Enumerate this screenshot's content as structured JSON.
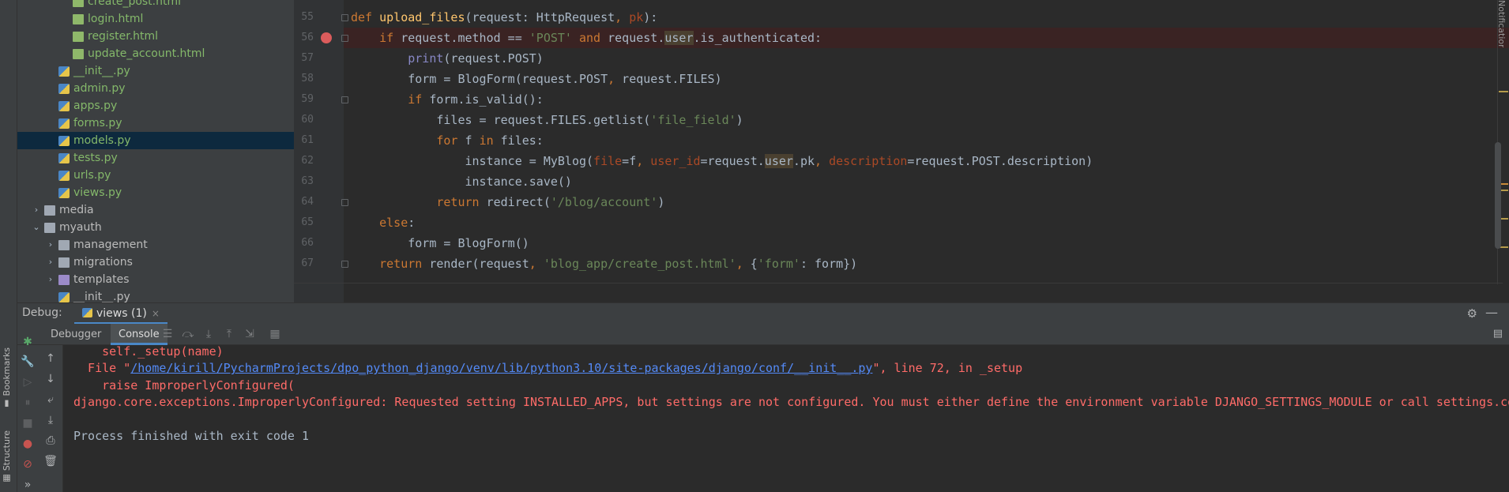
{
  "left_strip": {
    "bookmarks_label": "Bookmarks",
    "structure_label": "Structure"
  },
  "project_tree": {
    "items": [
      {
        "label": "create_post.html",
        "type": "html",
        "depth": 3,
        "color": "green"
      },
      {
        "label": "login.html",
        "type": "html",
        "depth": 3,
        "color": "green"
      },
      {
        "label": "register.html",
        "type": "html",
        "depth": 3,
        "color": "green"
      },
      {
        "label": "update_account.html",
        "type": "html",
        "depth": 3,
        "color": "green"
      },
      {
        "label": "__init__.py",
        "type": "py",
        "depth": 2,
        "color": "green"
      },
      {
        "label": "admin.py",
        "type": "py",
        "depth": 2,
        "color": "green"
      },
      {
        "label": "apps.py",
        "type": "py",
        "depth": 2,
        "color": "green"
      },
      {
        "label": "forms.py",
        "type": "py",
        "depth": 2,
        "color": "green"
      },
      {
        "label": "models.py",
        "type": "py",
        "depth": 2,
        "color": "green",
        "selected": true
      },
      {
        "label": "tests.py",
        "type": "py",
        "depth": 2,
        "color": "green"
      },
      {
        "label": "urls.py",
        "type": "py",
        "depth": 2,
        "color": "green"
      },
      {
        "label": "views.py",
        "type": "py",
        "depth": 2,
        "color": "green"
      },
      {
        "label": "media",
        "type": "folder",
        "depth": 1,
        "arrow": "›",
        "color": "plain"
      },
      {
        "label": "myauth",
        "type": "folder",
        "depth": 1,
        "arrow": "⌄",
        "color": "plain"
      },
      {
        "label": "management",
        "type": "folder",
        "depth": 2,
        "arrow": "›",
        "color": "plain"
      },
      {
        "label": "migrations",
        "type": "folder",
        "depth": 2,
        "arrow": "›",
        "color": "plain"
      },
      {
        "label": "templates",
        "type": "folder-purple",
        "depth": 2,
        "arrow": "›",
        "color": "plain"
      },
      {
        "label": "__init__.py",
        "type": "py",
        "depth": 2,
        "color": "plain"
      }
    ]
  },
  "editor": {
    "top_partial": "new",
    "lines": [
      {
        "num": "55",
        "tokens": [
          [
            "kw",
            "def "
          ],
          [
            "fn",
            "upload_files"
          ],
          [
            "",
            "(request: HttpRequest"
          ],
          [
            "kw",
            ", "
          ],
          [
            "param",
            "pk"
          ],
          [
            "",
            "):"
          ]
        ]
      },
      {
        "num": "56",
        "tokens": [
          [
            "",
            "    "
          ],
          [
            "kw",
            "if "
          ],
          [
            "",
            "request.method == "
          ],
          [
            "str",
            "'POST' "
          ],
          [
            "kw",
            "and "
          ],
          [
            "",
            "request."
          ],
          [
            "hlvar",
            "user"
          ],
          [
            "",
            ".is_authenticated:"
          ]
        ],
        "breakpoint": true
      },
      {
        "num": "57",
        "tokens": [
          [
            "",
            "        "
          ],
          [
            "builtin",
            "print"
          ],
          [
            "",
            "(request.POST)"
          ]
        ]
      },
      {
        "num": "58",
        "tokens": [
          [
            "",
            "        form = BlogForm(request.POST"
          ],
          [
            "kw",
            ", "
          ],
          [
            "",
            "request.FILES)"
          ]
        ]
      },
      {
        "num": "59",
        "tokens": [
          [
            "",
            "        "
          ],
          [
            "kw",
            "if "
          ],
          [
            "",
            "form.is_valid():"
          ]
        ]
      },
      {
        "num": "60",
        "tokens": [
          [
            "",
            "            files = request.FILES.getlist("
          ],
          [
            "str",
            "'file_field'"
          ],
          [
            "",
            ")"
          ]
        ]
      },
      {
        "num": "61",
        "tokens": [
          [
            "",
            "            "
          ],
          [
            "kw",
            "for "
          ],
          [
            "",
            "f "
          ],
          [
            "kw",
            "in "
          ],
          [
            "",
            "files:"
          ]
        ]
      },
      {
        "num": "62",
        "tokens": [
          [
            "",
            "                instance = MyBlog("
          ],
          [
            "param",
            "file"
          ],
          [
            "",
            "=f"
          ],
          [
            "kw",
            ", "
          ],
          [
            "param",
            "user_id"
          ],
          [
            "",
            "=request."
          ],
          [
            "hlvar",
            "user"
          ],
          [
            "",
            ".pk"
          ],
          [
            "kw",
            ", "
          ],
          [
            "param",
            "description"
          ],
          [
            "",
            "=request.POST.description)"
          ]
        ]
      },
      {
        "num": "63",
        "tokens": [
          [
            "",
            "                instance.save()"
          ]
        ]
      },
      {
        "num": "64",
        "tokens": [
          [
            "",
            "            "
          ],
          [
            "kw",
            "return "
          ],
          [
            "",
            "redirect("
          ],
          [
            "str",
            "'/blog/account'"
          ],
          [
            "",
            ")"
          ]
        ]
      },
      {
        "num": "65",
        "tokens": [
          [
            "",
            "    "
          ],
          [
            "kw",
            "else"
          ],
          [
            "",
            ":"
          ]
        ]
      },
      {
        "num": "66",
        "tokens": [
          [
            "",
            "        form = BlogForm()"
          ]
        ]
      },
      {
        "num": "67",
        "tokens": [
          [
            "",
            "    "
          ],
          [
            "kw",
            "return "
          ],
          [
            "",
            "render(request"
          ],
          [
            "kw",
            ", "
          ],
          [
            "str",
            "'blog_app/create_post.html'"
          ],
          [
            "kw",
            ", "
          ],
          [
            "",
            "{"
          ],
          [
            "str",
            "'form'"
          ],
          [
            "",
            ": form})"
          ]
        ]
      }
    ]
  },
  "notifications_label": "Notifications",
  "debug": {
    "title": "Debug:",
    "tab_label": "views (1)",
    "tab_close": "×",
    "subtabs": {
      "debugger": "Debugger",
      "console": "Console"
    },
    "console_lines": [
      {
        "text": "    self._setup(name)",
        "kind": "error"
      },
      {
        "pre": "  File \"",
        "link": "/home/kirill/PycharmProjects/dpo_python_django/venv/lib/python3.10/site-packages/django/conf/__init__.py",
        "post": "\", line 72, in _setup",
        "kind": "error"
      },
      {
        "text": "    raise ImproperlyConfigured(",
        "kind": "error"
      },
      {
        "text": "django.core.exceptions.ImproperlyConfigured: Requested setting INSTALLED_APPS, but settings are not configured. You must either define the environment variable DJANGO_SETTINGS_MODULE or call settings.configure() before accessing settings.",
        "kind": "error"
      },
      {
        "text": "",
        "kind": "normal"
      },
      {
        "text": "Process finished with exit code 1",
        "kind": "normal"
      }
    ]
  },
  "colors": {
    "accent": "#4a88c7",
    "error_text": "#ff6b68",
    "link": "#548af7",
    "breakpoint": "#db5c5c"
  }
}
